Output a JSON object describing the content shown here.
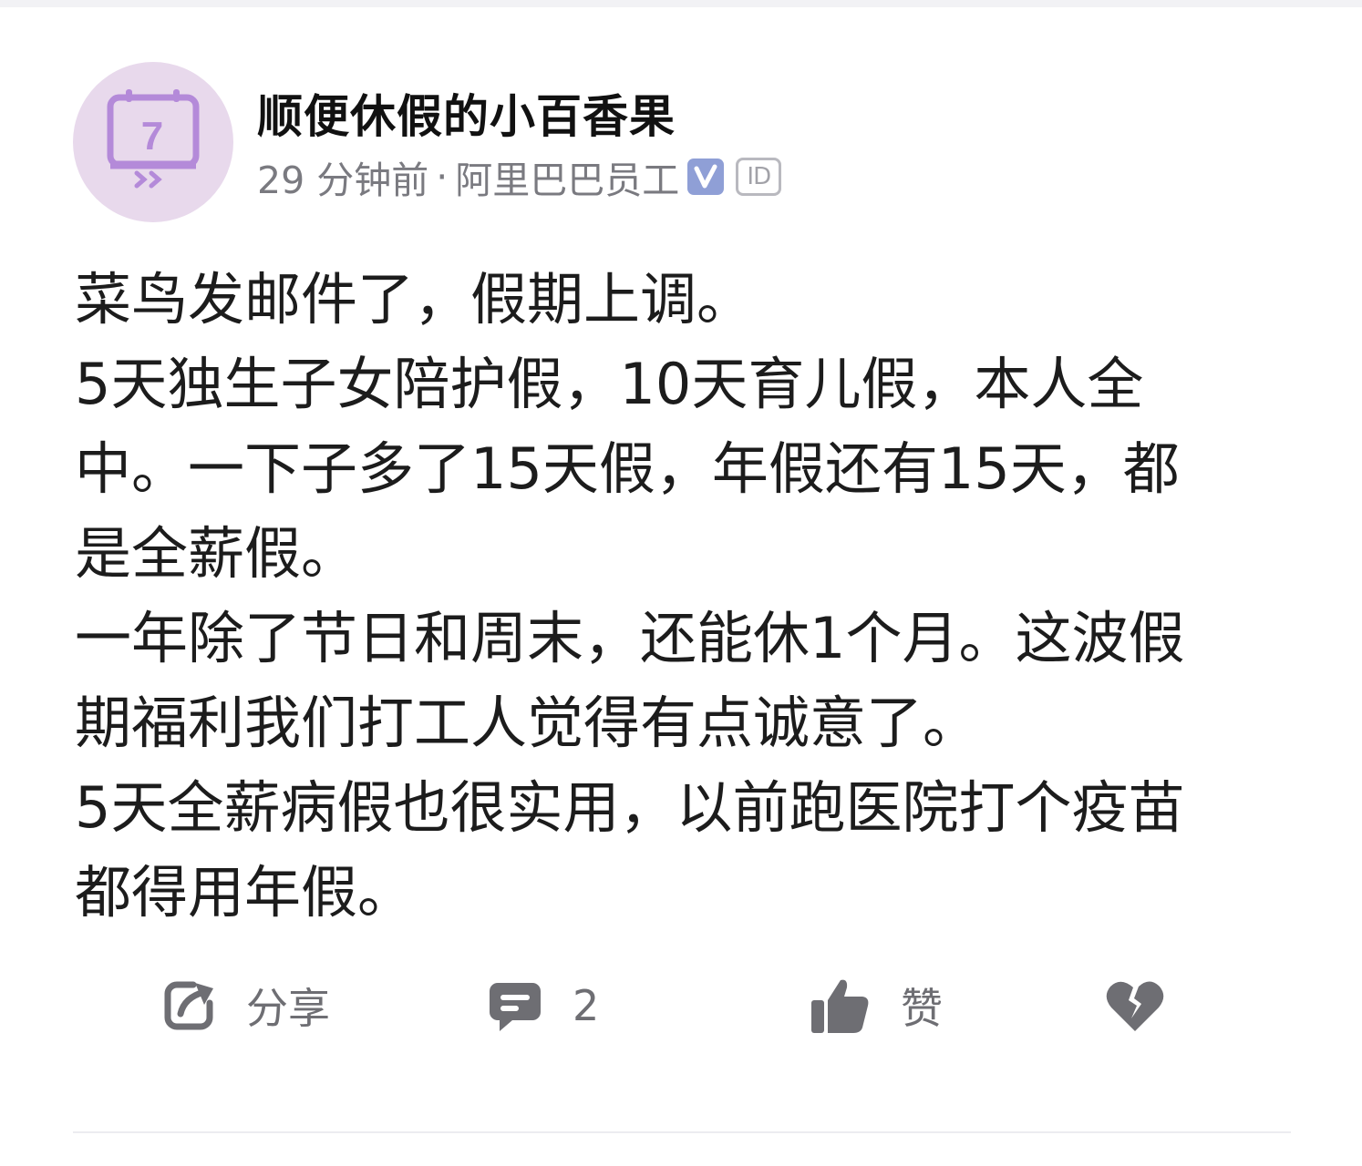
{
  "post": {
    "author": {
      "name": "顺便休假的小百香果",
      "avatar_icon": "calendar-7-icon",
      "avatar_number": "7",
      "avatar_color": "#e8d9ec"
    },
    "meta": {
      "time": "29 分钟前",
      "separator": "·",
      "company": "阿里巴巴员工",
      "verified_icon": "verified-v-icon",
      "id_badge": "ID"
    },
    "body_lines": [
      "菜鸟发邮件了，假期上调。",
      "5天独生子女陪护假，10天育儿假，本人全",
      "中。一下子多了15天假，年假还有15天，都",
      "是全薪假。",
      "一年除了节日和周末，还能休1个月。这波假",
      "期福利我们打工人觉得有点诚意了。",
      "5天全薪病假也很实用，以前跑医院打个疫苗",
      "都得用年假。"
    ]
  },
  "actions": {
    "share": {
      "label": "分享",
      "icon": "share-icon"
    },
    "comment": {
      "count": "2",
      "icon": "comment-icon"
    },
    "like": {
      "label": "赞",
      "icon": "thumbs-up-icon"
    },
    "dislike": {
      "icon": "broken-heart-icon"
    }
  },
  "colors": {
    "icon_gray": "#6e6e73",
    "verified_blue": "#8f9fd6",
    "avatar_purple": "#b48ad9"
  }
}
